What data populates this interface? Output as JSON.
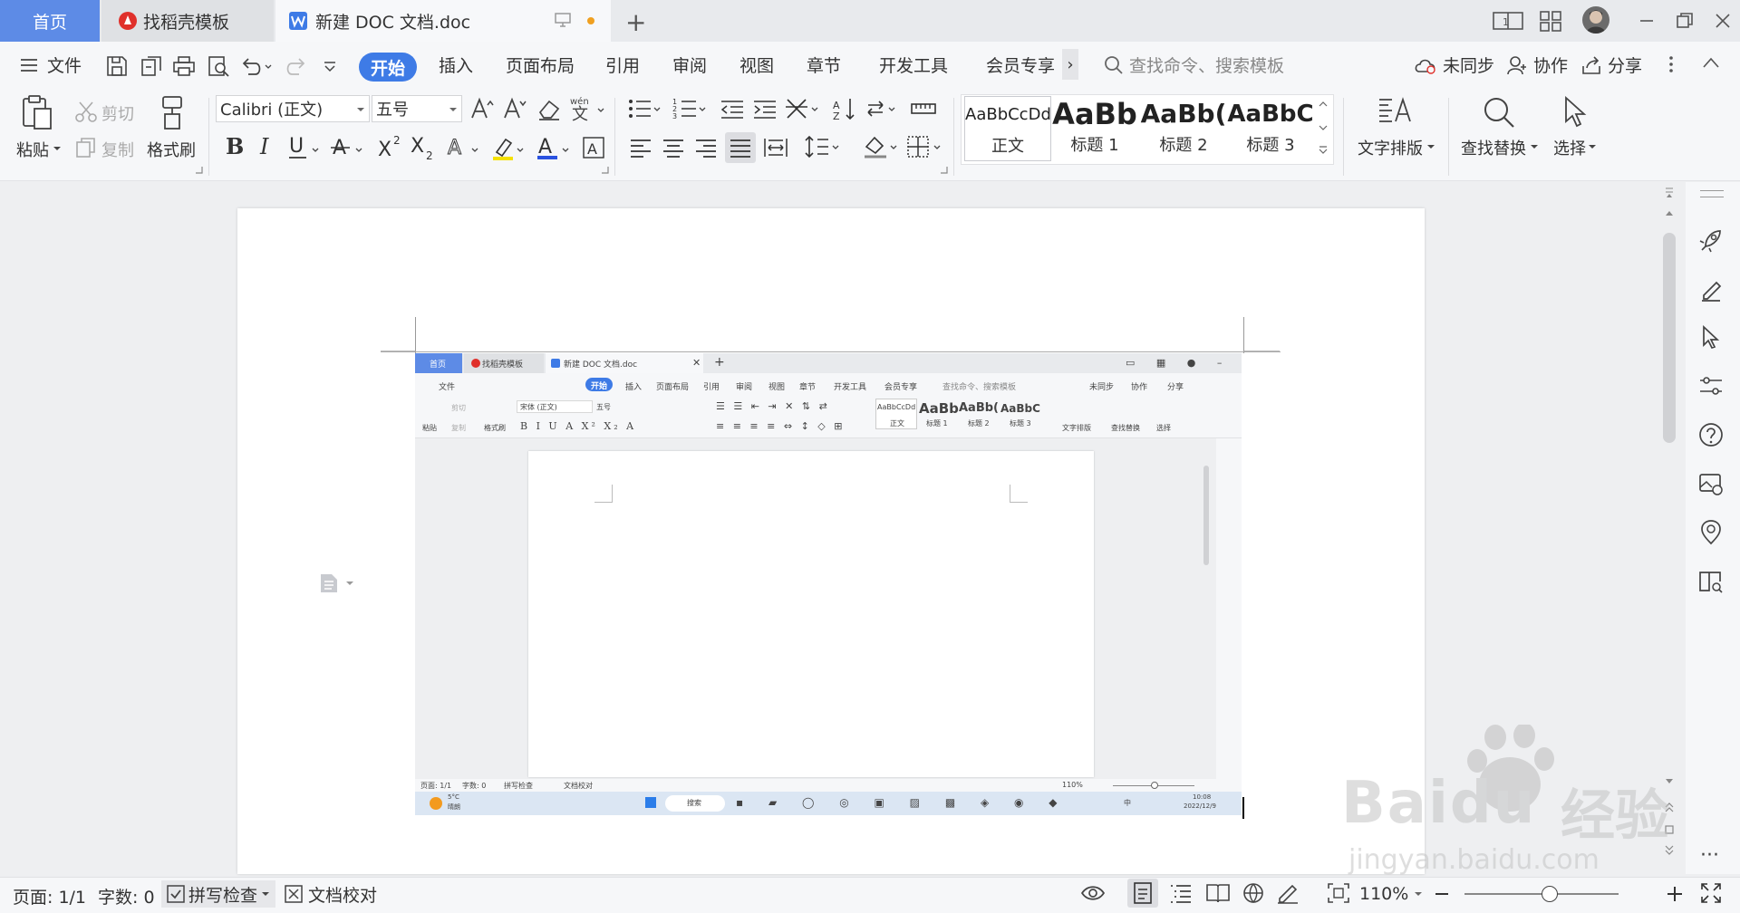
{
  "titlebar": {
    "tabs": [
      {
        "label": "首页"
      },
      {
        "label": "找稻壳模板"
      },
      {
        "label": "新建 DOC 文档.doc"
      }
    ],
    "new_tab": "+"
  },
  "menubar": {
    "file": "文件",
    "items": [
      "开始",
      "插入",
      "页面布局",
      "引用",
      "审阅",
      "视图",
      "章节",
      "开发工具",
      "会员专享"
    ],
    "more": "›",
    "search_placeholder": "查找命令、搜索模板",
    "right": {
      "sync": "未同步",
      "collab": "协作",
      "share": "分享"
    }
  },
  "ribbon": {
    "paste": "粘贴",
    "cut": "剪切",
    "copy": "复制",
    "format_painter": "格式刷",
    "font_name": "Calibri (正文)",
    "font_size": "五号",
    "styles": [
      {
        "preview": "AaBbCcDd",
        "name": "正文"
      },
      {
        "preview": "AaBb",
        "name": "标题 1"
      },
      {
        "preview": "AaBb(",
        "name": "标题 2"
      },
      {
        "preview": "AaBbC",
        "name": "标题 3"
      }
    ],
    "text_layout": "文字排版",
    "find_replace": "查找替换",
    "select": "选择"
  },
  "embedded": {
    "tabs": [
      "首页",
      "找稻壳模板",
      "新建 DOC 文档.doc"
    ],
    "menu": [
      "文件",
      "开始",
      "插入",
      "页面布局",
      "引用",
      "审阅",
      "视图",
      "章节",
      "开发工具",
      "会员专享"
    ],
    "search": "查找命令、搜索模板",
    "right": [
      "未同步",
      "协作",
      "分享"
    ],
    "ribbon": {
      "paste": "粘贴",
      "cut": "剪切",
      "copy": "复制",
      "painter": "格式刷",
      "font": "宋体 (正文)",
      "size": "五号",
      "styles": [
        "正文",
        "标题 1",
        "标题 2",
        "标题 3"
      ],
      "layout": "文字排版",
      "find": "查找替换",
      "select": "选择"
    },
    "style_previews": [
      "AaBbCcDd",
      "AaBb",
      "AaBb(",
      "AaBbC"
    ],
    "status": {
      "page": "页面: 1/1",
      "words": "字数: 0",
      "spell": "拼写检查",
      "proof": "文档校对",
      "zoom": "110%"
    },
    "taskbar": {
      "temp": "5°C",
      "weather": "晴朗",
      "search": "搜索",
      "time": "10:08",
      "date": "2022/12/9",
      "ime": "中"
    }
  },
  "statusbar": {
    "page": "页面: 1/1",
    "words": "字数: 0",
    "spell": "拼写检查",
    "proof": "文档校对",
    "zoom": "110%",
    "zoom_level": 0.55
  },
  "watermark": {
    "brand": "Baidu",
    "cn": "经验",
    "url": "jingyan.baidu.com"
  },
  "colors": {
    "accent": "#3e7be6",
    "home_tab": "#5d8be6",
    "wps_red": "#e0302b"
  }
}
